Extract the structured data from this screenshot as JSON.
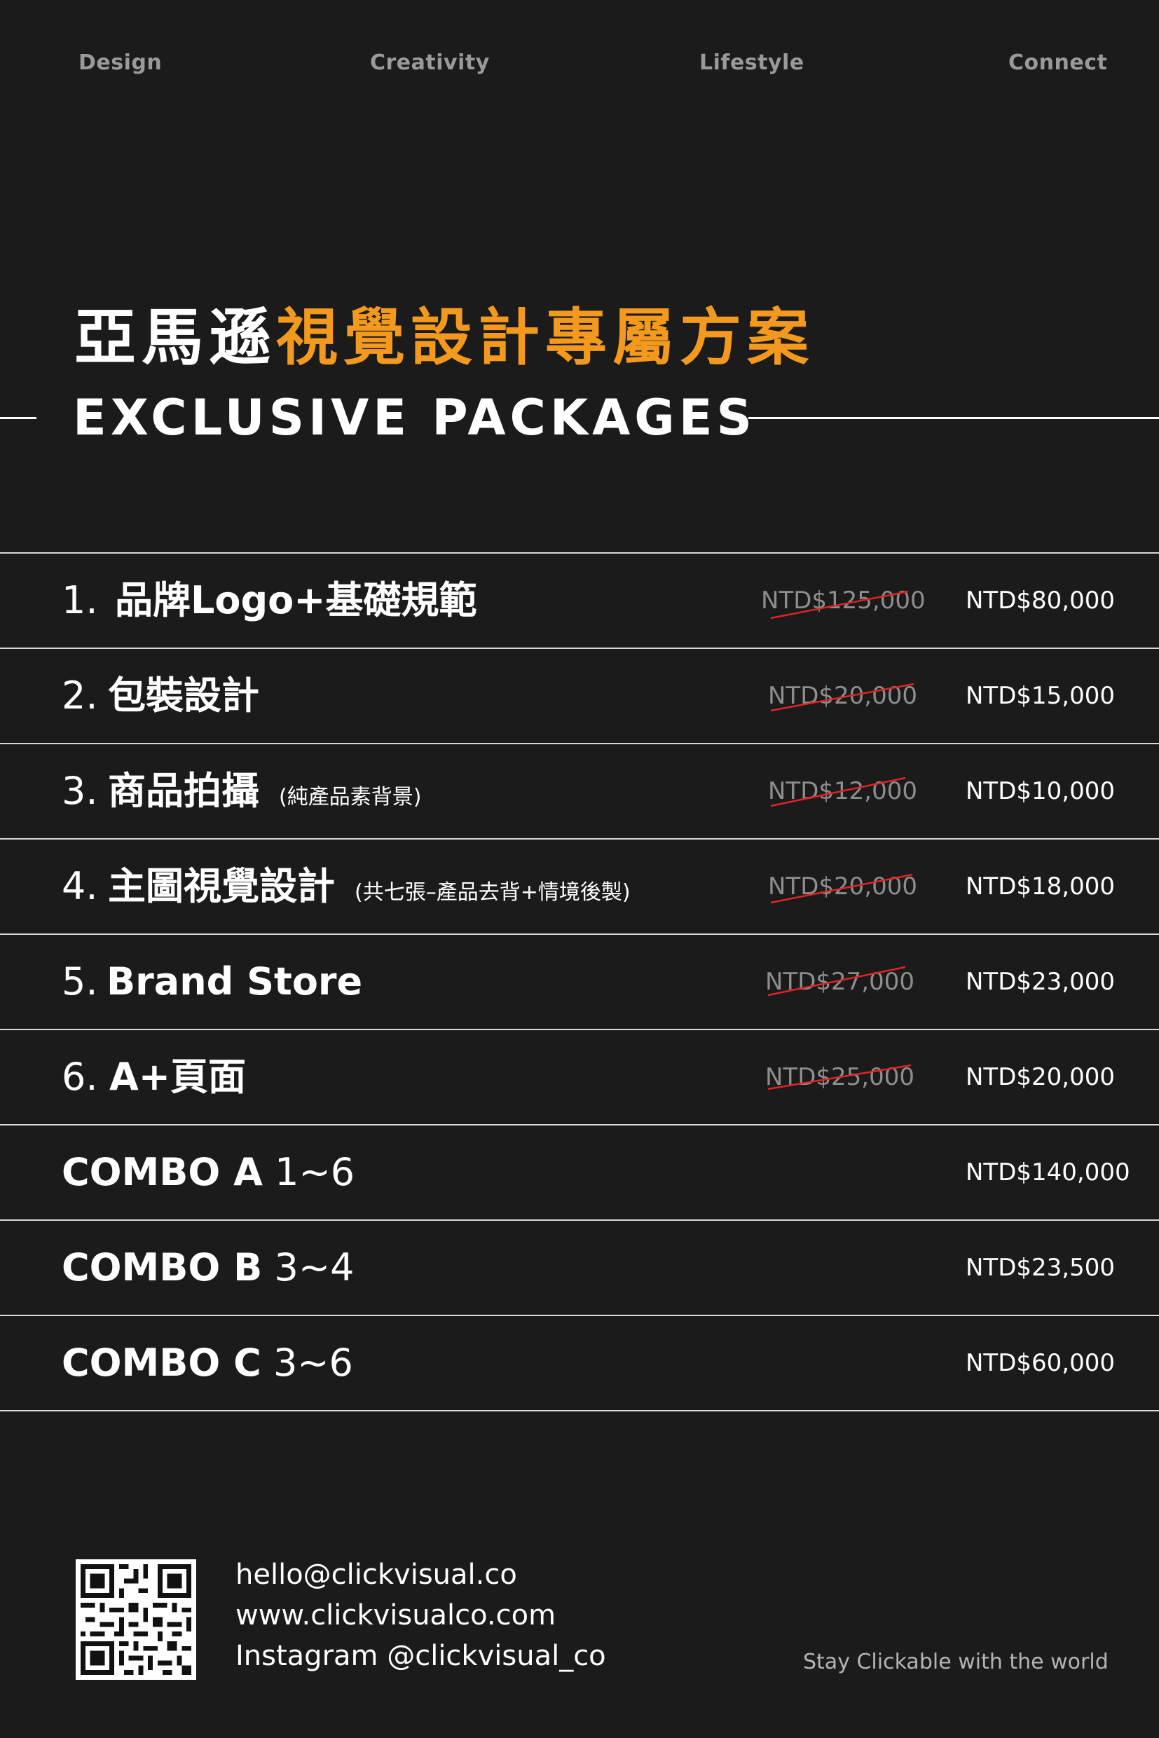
{
  "nav": [
    "Design",
    "Creativity",
    "Lifestyle",
    "Connect"
  ],
  "heading": {
    "zh_white": "亞馬遜",
    "zh_orange": "視覺設計專屬方案",
    "en": "EXCLUSIVE PACKAGES"
  },
  "packages": [
    {
      "num": "1.",
      "name": "品牌Logo+基礎規範",
      "note": "",
      "old_price": "NTD$125,000",
      "price": "NTD$80,000"
    },
    {
      "num": "2.",
      "name": "包裝設計",
      "note": "",
      "old_price": "NTD$20,000",
      "price": "NTD$15,000"
    },
    {
      "num": "3.",
      "name": "商品拍攝",
      "note": "(純產品素背景)",
      "old_price": "NTD$12,000",
      "price": "NTD$10,000"
    },
    {
      "num": "4.",
      "name": "主圖視覺設計",
      "note": "(共七張–產品去背+情境後製)",
      "old_price": "NTD$20,000",
      "price": "NTD$18,000"
    },
    {
      "num": "5.",
      "name": "Brand Store",
      "note": "",
      "old_price": "NTD$27,000",
      "price": "NTD$23,000"
    },
    {
      "num": "6.",
      "name": "A+頁面",
      "note": "",
      "old_price": "NTD$25,000",
      "price": "NTD$20,000"
    }
  ],
  "combos": [
    {
      "label": "COMBO A",
      "range": "1~6",
      "price": "NTD$140,000"
    },
    {
      "label": "COMBO B",
      "range": "3~4",
      "price": "NTD$23,500"
    },
    {
      "label": "COMBO C",
      "range": "3~6",
      "price": "NTD$60,000"
    }
  ],
  "contact": {
    "email": "hello@clickvisual.co",
    "website": "www.clickvisualco.com",
    "instagram": "Instagram @clickvisual_co"
  },
  "tagline": "Stay Clickable with the world",
  "colors": {
    "background": "#1b1b1c",
    "accent": "#f39a1e",
    "strike": "#e02424",
    "muted": "#8e8e8e"
  },
  "icons": {
    "qr": "qr-code-icon"
  }
}
